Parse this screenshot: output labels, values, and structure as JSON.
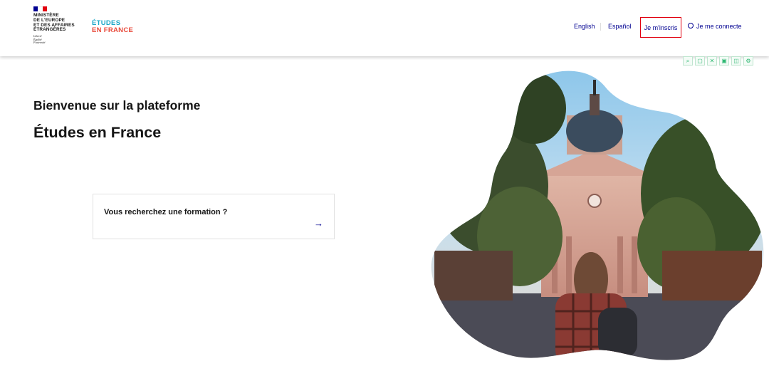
{
  "header": {
    "ministry_text": "MINISTÈRE\nDE L'EUROPE\nET DES AFFAIRES\nÉTRANGÈRES",
    "motto_text": "Liberté\nÉgalité\nFraternité",
    "brand_line1": "ÉTUDES",
    "brand_line2": "EN FRANCE",
    "nav": {
      "english": "English",
      "spanish": "Español",
      "register": "Je m'inscris",
      "login": "Je me connecte"
    }
  },
  "tools": [
    "search-icon",
    "copy-icon",
    "expand-icon",
    "save-icon",
    "image-icon",
    "settings-icon"
  ],
  "hero": {
    "welcome": "Bienvenue sur la plateforme",
    "title": "Études en France",
    "search_card_label": "Vous recherchez une formation ?"
  },
  "colors": {
    "nav_blue": "#000091",
    "highlight_red": "#e1000f",
    "brand_cyan": "#1aa6c6",
    "brand_red": "#e84a3b"
  }
}
